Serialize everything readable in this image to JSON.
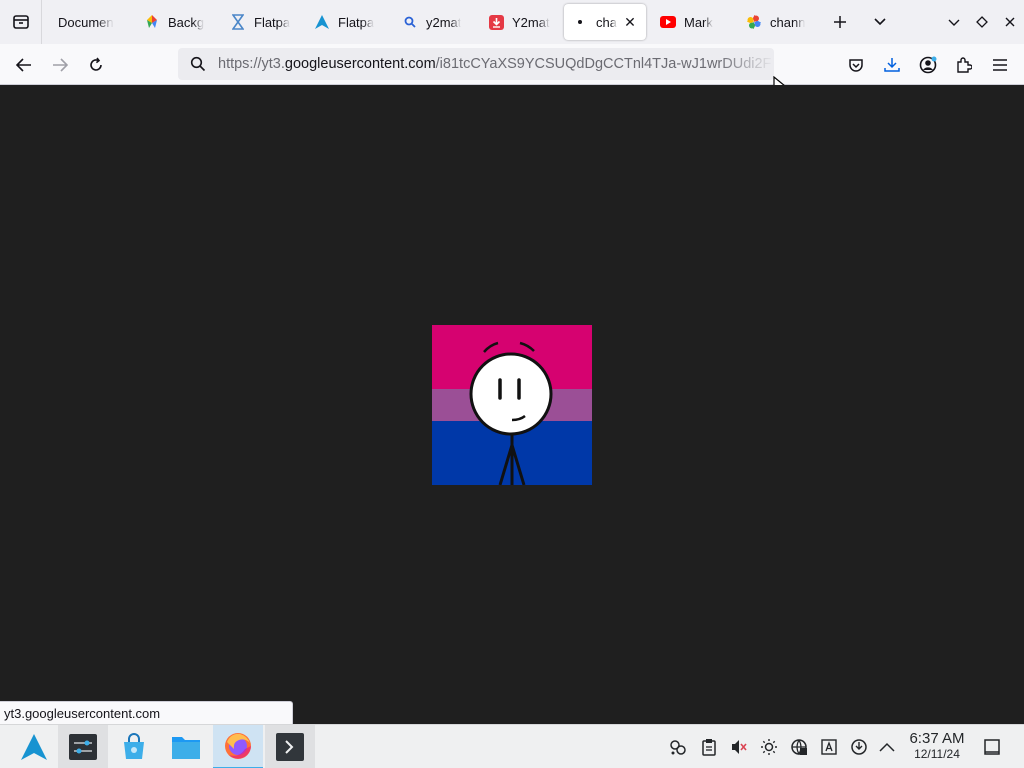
{
  "browser": {
    "tabs": [
      {
        "title": "Documen",
        "icon": "document-icon",
        "active": false
      },
      {
        "title": "Backg",
        "icon": "pinwheel-icon",
        "active": false
      },
      {
        "title": "Flatpa",
        "icon": "hourglass-icon",
        "active": false
      },
      {
        "title": "Flatpa",
        "icon": "arch-icon",
        "active": false
      },
      {
        "title": "y2mat",
        "icon": "search-icon",
        "active": false
      },
      {
        "title": "Y2mat",
        "icon": "download-icon",
        "active": false
      },
      {
        "title": "cha",
        "icon": "dot-icon",
        "active": true
      },
      {
        "title": "Mark",
        "icon": "youtube-icon",
        "active": false
      },
      {
        "title": "chann",
        "icon": "photos-icon",
        "active": false
      }
    ],
    "url": {
      "prefix": "https://yt3.",
      "host": "googleusercontent.com",
      "path": "/i81tcCYaXS9YCSUQdDgCCTnl4TJa-wJ1wrDUdi2F"
    },
    "status_url": "yt3.googleusercontent.com"
  },
  "image": {
    "flag_colors": [
      "#d60270",
      "#9b4f96",
      "#0038a8"
    ]
  },
  "taskbar": {
    "time": "6:37 AM",
    "date": "12/11/24"
  },
  "colors": {
    "content_bg": "#1f1f1f",
    "accent": "#3daee9",
    "download_accent": "#0060df"
  }
}
